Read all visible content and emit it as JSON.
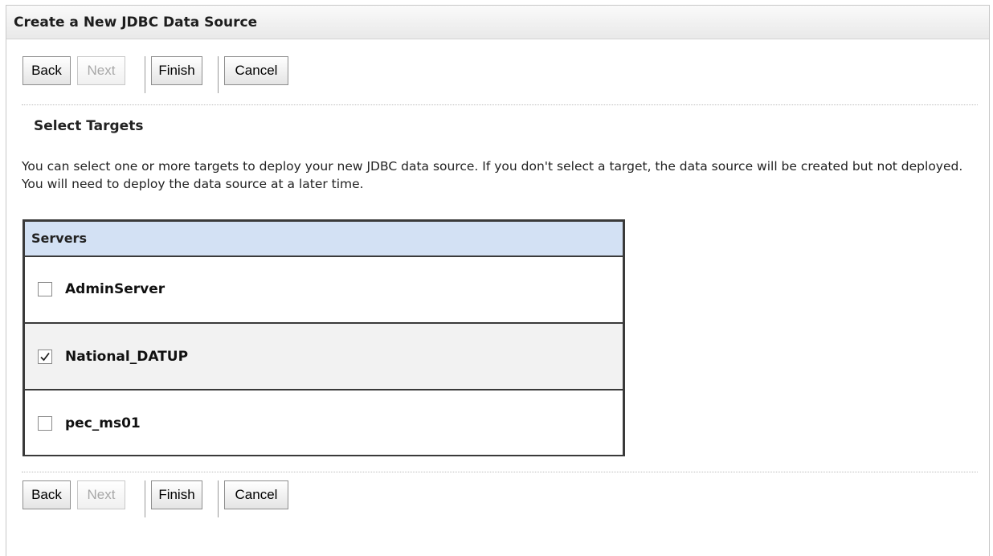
{
  "panel": {
    "title": "Create a New JDBC Data Source"
  },
  "buttons": {
    "back": "Back",
    "next": "Next",
    "finish": "Finish",
    "cancel": "Cancel"
  },
  "section": {
    "title": "Select Targets",
    "description": "You can select one or more targets to deploy your new JDBC data source. If you don't select a target, the data source will be created but not deployed. You will need to deploy the data source at a later time."
  },
  "servers": {
    "header": "Servers",
    "rows": [
      {
        "name": "AdminServer",
        "checked": false
      },
      {
        "name": "National_DATUP",
        "checked": true
      },
      {
        "name": "pec_ms01",
        "checked": false
      }
    ]
  }
}
